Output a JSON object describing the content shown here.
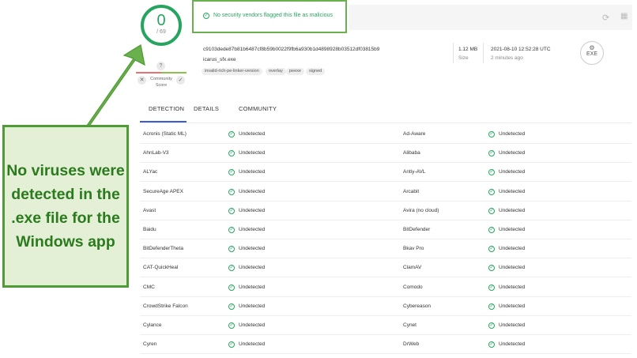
{
  "score": {
    "value": "0",
    "total": "/ 69"
  },
  "community": {
    "help": "?",
    "label_line1": "Community",
    "label_line2": "Score",
    "down": "✕",
    "up": "✓"
  },
  "banner": {
    "text": "No security vendors flagged this file as malicious"
  },
  "file": {
    "hash": "c9103dede87b81b6487cf8b59b0022f9fb6a930b1d4898928b03512df03815b9",
    "name": "icarus_sfx.exe",
    "tags": [
      "invalid-rich-pe-linker-version",
      "overlay",
      "peexe",
      "signed"
    ],
    "size": "1.12 MB",
    "size_label": "Size",
    "date": "2021-08-10 12:52:28 UTC",
    "date_ago": "2 minutes ago",
    "type": "EXE"
  },
  "tabs": [
    "DETECTION",
    "DETAILS",
    "COMMUNITY"
  ],
  "detections": [
    {
      "left": "Acronis (Static ML)",
      "left_status": "Undetected",
      "right": "Ad-Aware",
      "right_status": "Undetected"
    },
    {
      "left": "AhnLab-V3",
      "left_status": "Undetected",
      "right": "Alibaba",
      "right_status": "Undetected"
    },
    {
      "left": "ALYac",
      "left_status": "Undetected",
      "right": "Antiy-AVL",
      "right_status": "Undetected"
    },
    {
      "left": "SecureAge APEX",
      "left_status": "Undetected",
      "right": "Arcabit",
      "right_status": "Undetected"
    },
    {
      "left": "Avast",
      "left_status": "Undetected",
      "right": "Avira (no cloud)",
      "right_status": "Undetected"
    },
    {
      "left": "Baidu",
      "left_status": "Undetected",
      "right": "BitDefender",
      "right_status": "Undetected"
    },
    {
      "left": "BitDefenderTheta",
      "left_status": "Undetected",
      "right": "Bkav Pro",
      "right_status": "Undetected"
    },
    {
      "left": "CAT-QuickHeal",
      "left_status": "Undetected",
      "right": "ClamAV",
      "right_status": "Undetected"
    },
    {
      "left": "CMC",
      "left_status": "Undetected",
      "right": "Comodo",
      "right_status": "Undetected"
    },
    {
      "left": "CrowdStrike Falcon",
      "left_status": "Undetected",
      "right": "Cybereason",
      "right_status": "Undetected"
    },
    {
      "left": "Cylance",
      "left_status": "Undetected",
      "right": "Cynet",
      "right_status": "Undetected"
    },
    {
      "left": "Cyren",
      "left_status": "Undetected",
      "right": "DrWeb",
      "right_status": "Undetected"
    }
  ],
  "callout": {
    "text": "No viruses were detected in the .exe file for the Windows app"
  },
  "colors": {
    "accent_green": "#27a560",
    "callout_border": "#4f9b35",
    "callout_bg": "#e3f0d6",
    "tab_active": "#3b5bdb"
  }
}
